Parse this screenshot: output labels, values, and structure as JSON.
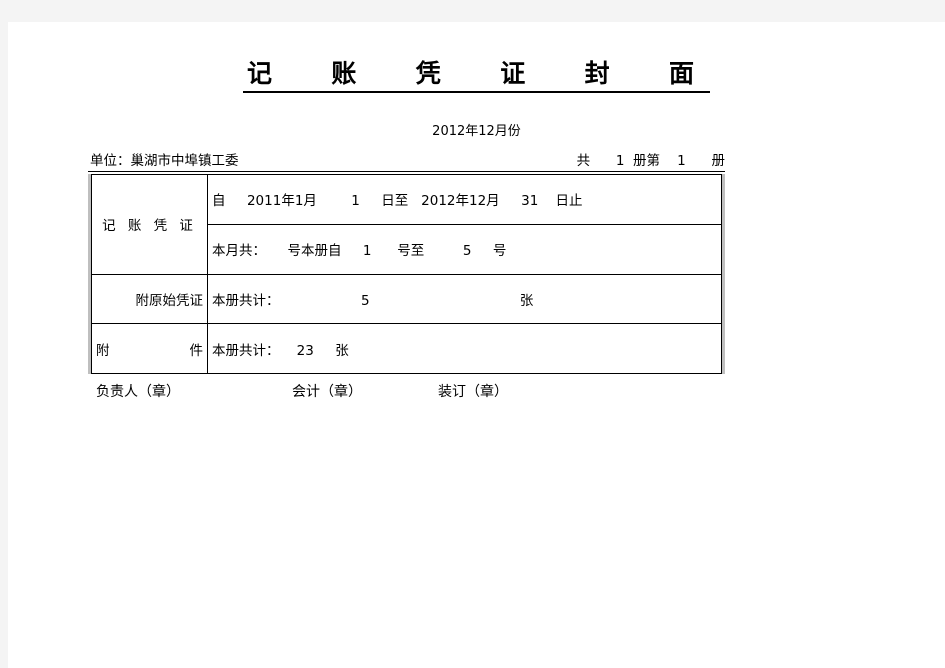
{
  "document": {
    "title": "记  账  凭  证  封  面",
    "subtitle": "2012年12月份"
  },
  "header": {
    "unit_label": "单位：巢湖市中埠镇工委",
    "volume_label": "共      1  册第    1      册"
  },
  "table": {
    "rows": [
      {
        "label": "记 账 凭 证",
        "label_style": "spread",
        "rowspan": 2,
        "body": "自     2011年1月        1     日至   2012年12月     31    日止"
      },
      {
        "label": "",
        "body": "本月共：     号本册自     1      号至         5     号"
      },
      {
        "label": "附原始凭证",
        "label_style": "right",
        "body": "本册共计：                   5                                   张"
      },
      {
        "label": "附           件",
        "label_style": "wide",
        "body": "本册共计：    23     张"
      }
    ]
  },
  "footer": {
    "signatures": [
      "负责人（章）",
      "会计（章）",
      "装订（章）"
    ]
  }
}
